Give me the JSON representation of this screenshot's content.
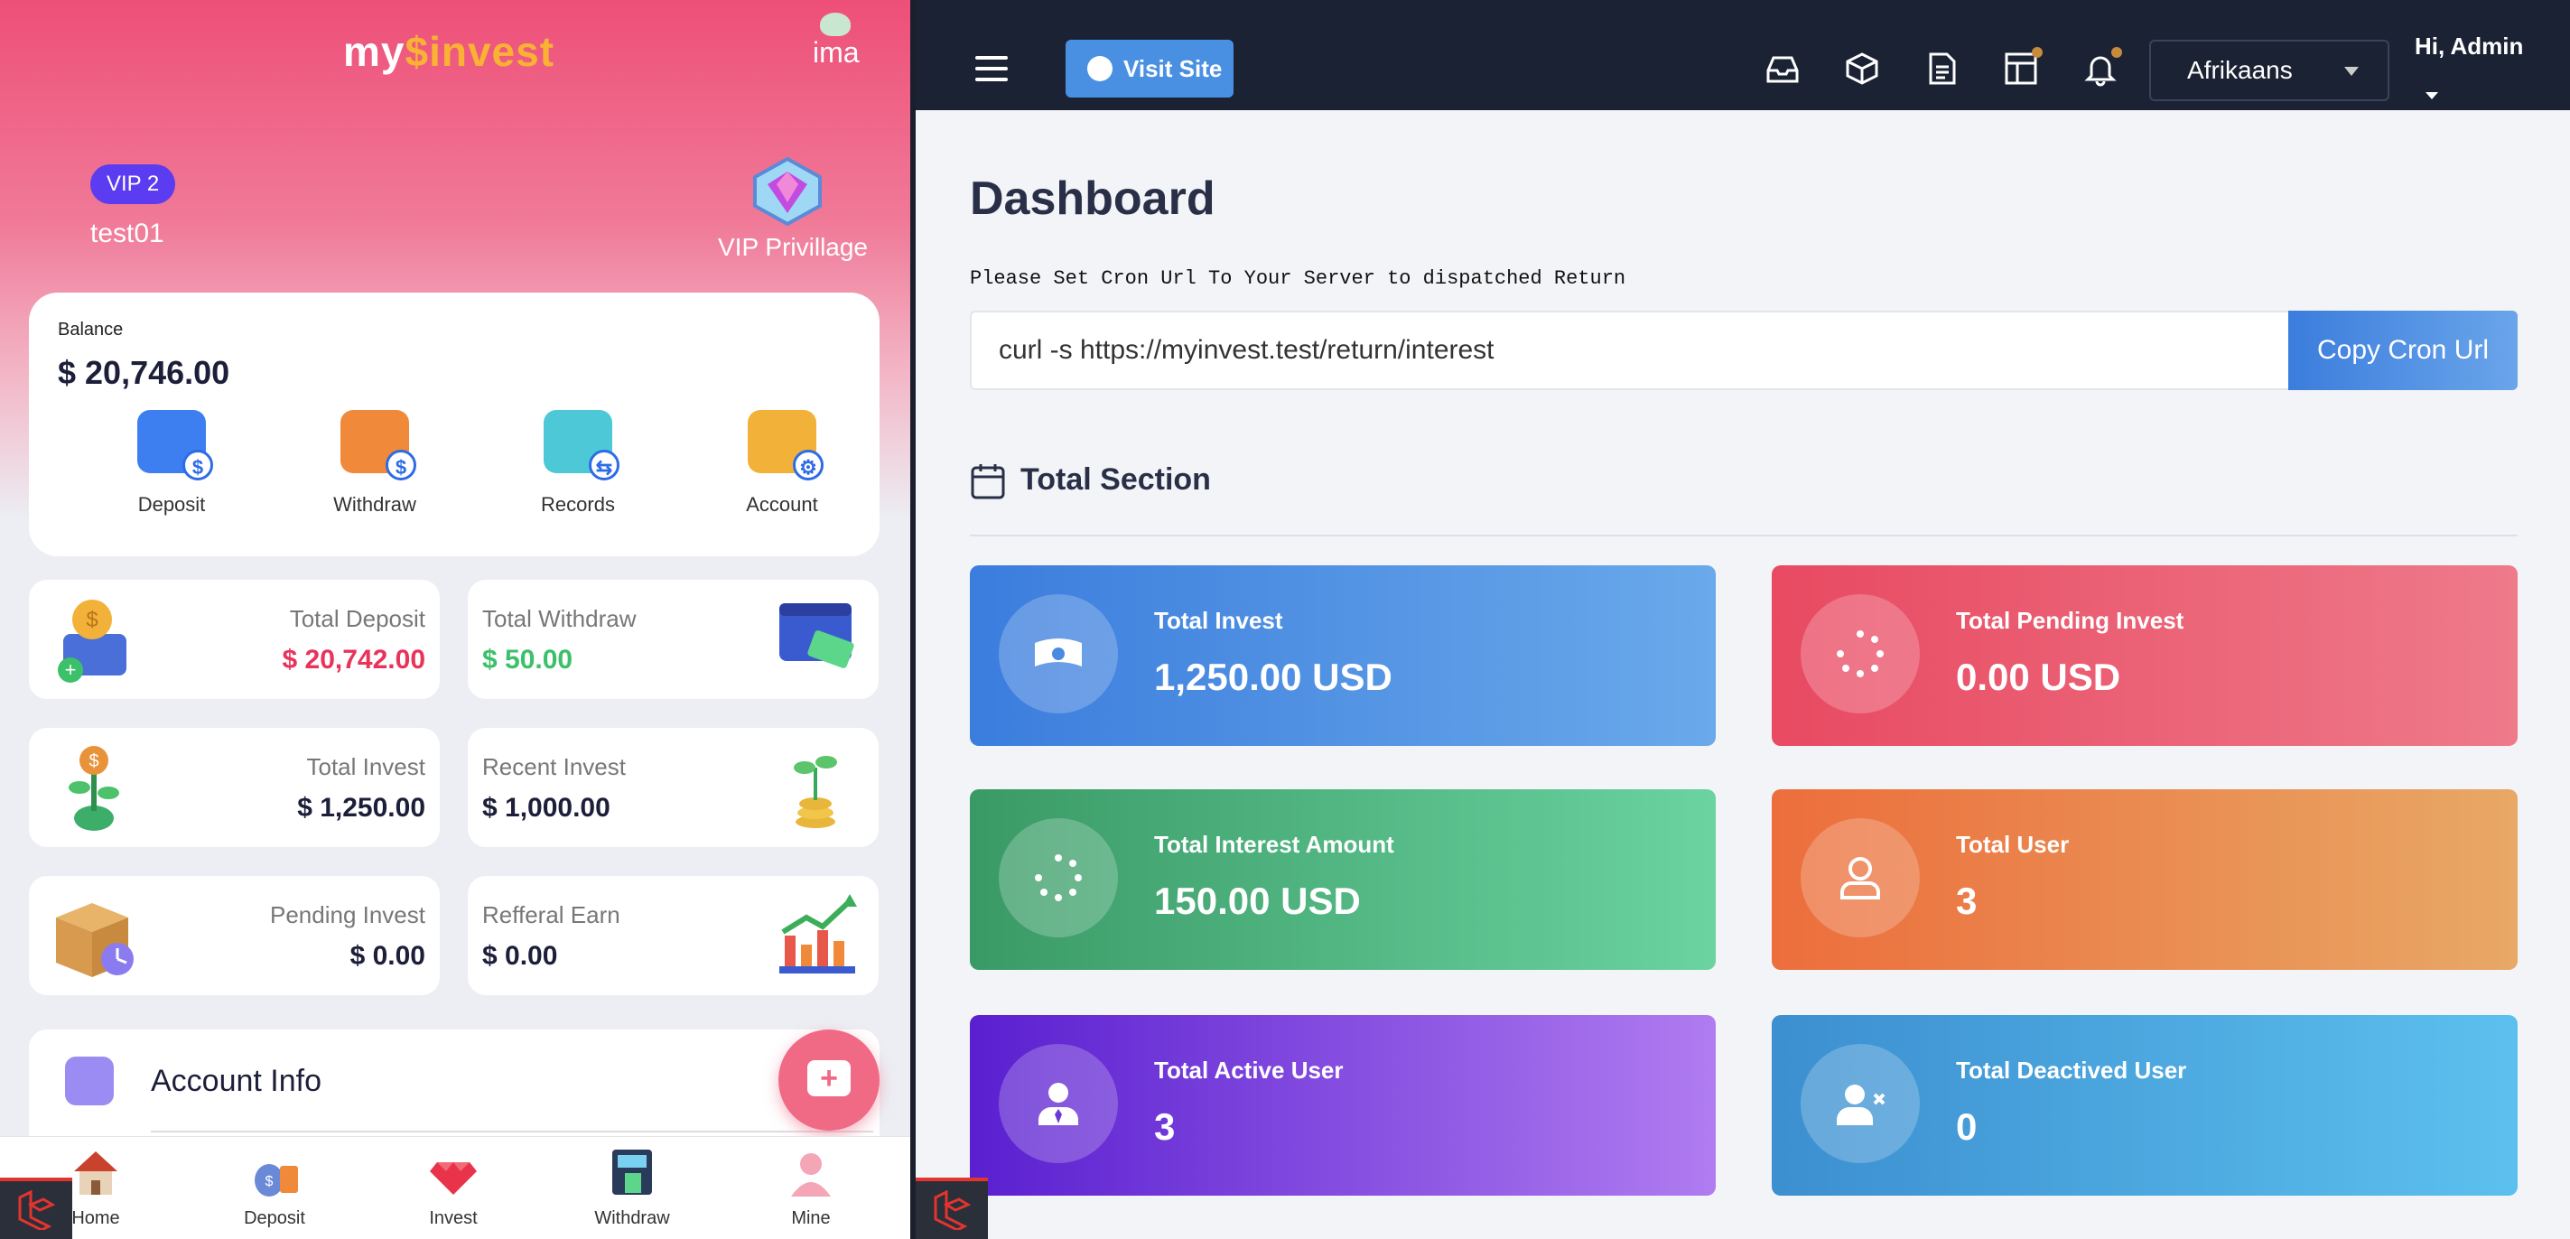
{
  "mobile": {
    "logo_left": "my",
    "logo_right": "invest",
    "avatar_text": "ima",
    "vip_badge": "VIP 2",
    "username": "test01",
    "vip_privilege_label": "VIP Privillage",
    "balance_label": "Balance",
    "balance_value": "$ 20,746.00",
    "quick_actions": [
      {
        "label": "Deposit",
        "icon": "wallet-icon",
        "color": "#3d7ff0"
      },
      {
        "label": "Withdraw",
        "icon": "card-icon",
        "color": "#f08a3a"
      },
      {
        "label": "Records",
        "icon": "records-icon",
        "color": "#4cc8d6"
      },
      {
        "label": "Account",
        "icon": "calendar-icon",
        "color": "#f2b23a"
      }
    ],
    "stats": [
      {
        "label": "Total Deposit",
        "value": "$ 20,742.00",
        "value_color": "#e8335a"
      },
      {
        "label": "Total Withdraw",
        "value": "$ 50.00",
        "value_color": "#3cc06a"
      },
      {
        "label": "Total Invest",
        "value": "$ 1,250.00",
        "value_color": "#1d1f3a"
      },
      {
        "label": "Recent Invest",
        "value": "$ 1,000.00",
        "value_color": "#1d1f3a"
      },
      {
        "label": "Pending Invest",
        "value": "$ 0.00",
        "value_color": "#1d1f3a"
      },
      {
        "label": "Refferal Earn",
        "value": "$ 0.00",
        "value_color": "#1d1f3a"
      }
    ],
    "account_info_label": "Account Info",
    "bottom_nav": [
      {
        "label": "Home",
        "icon": "home-icon"
      },
      {
        "label": "Deposit",
        "icon": "money-bag-icon"
      },
      {
        "label": "Invest",
        "icon": "diamond-icon"
      },
      {
        "label": "Withdraw",
        "icon": "atm-icon"
      },
      {
        "label": "Mine",
        "icon": "user-icon"
      }
    ]
  },
  "admin": {
    "visit_site_label": "Visit Site",
    "language": "Afrikaans",
    "greeting": "Hi, Admin",
    "page_title": "Dashboard",
    "cron_note": "Please Set Cron Url To Your Server to dispatched Return",
    "cron_url": "curl -s https://myinvest.test/return/interest",
    "copy_cron_label": "Copy Cron Url",
    "section_title": "Total Section",
    "tiles": [
      {
        "label": "Total Invest",
        "value": "1,250.00 USD",
        "icon": "money-icon",
        "gradient": [
          "#3b7ddd",
          "#6aa9ea"
        ]
      },
      {
        "label": "Total Pending Invest",
        "value": "0.00 USD",
        "icon": "spinner-icon",
        "gradient": [
          "#e84a62",
          "#ee7a8a"
        ]
      },
      {
        "label": "Total Interest Amount",
        "value": "150.00 USD",
        "icon": "spinner-icon",
        "gradient": [
          "#3a9a66",
          "#6ad3a0"
        ]
      },
      {
        "label": "Total User",
        "value": "3",
        "icon": "user-icon",
        "gradient": [
          "#ec6e3c",
          "#e8a866"
        ]
      },
      {
        "label": "Total Active User",
        "value": "3",
        "icon": "user-tie-icon",
        "gradient": [
          "#5a1fd0",
          "#b07cf0"
        ]
      },
      {
        "label": "Total Deactived User",
        "value": "0",
        "icon": "user-x-icon",
        "gradient": [
          "#3c8fd0",
          "#5cc0ee"
        ]
      }
    ]
  }
}
